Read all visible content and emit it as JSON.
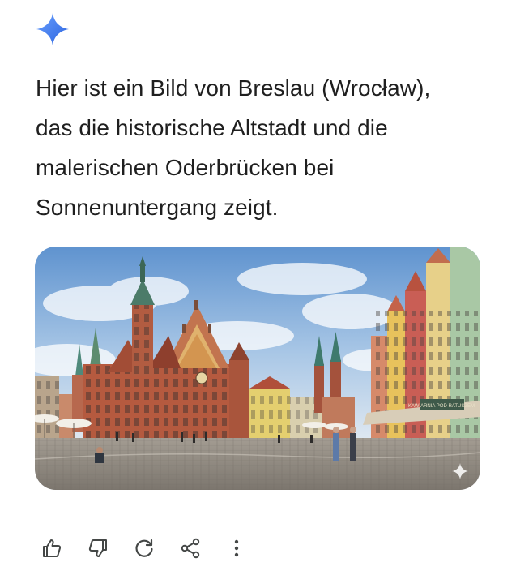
{
  "response": {
    "icon": "gemini-sparkle-icon",
    "lines": [
      "Hier ist ein Bild von Breslau (Wrocław),",
      "das die historische Altstadt und die",
      "malerischen Oderbrücken bei",
      "Sonnenuntergang zeigt."
    ]
  },
  "image": {
    "subject": "Wrocław market square with Old Town Hall and colorful townhouses",
    "sign_text": "KAWIARNIA POD RATUSZEM",
    "overlay_icon": "sparkle-watermark-icon"
  },
  "actions": [
    {
      "icon": "thumbs-up-icon"
    },
    {
      "icon": "thumbs-down-icon"
    },
    {
      "icon": "regenerate-icon"
    },
    {
      "icon": "share-icon"
    },
    {
      "icon": "more-options-icon"
    }
  ],
  "colors": {
    "sparkle_start": "#4f8cf7",
    "sparkle_end": "#2b6fe0",
    "text": "#1f1f1f",
    "icon": "#444746"
  }
}
